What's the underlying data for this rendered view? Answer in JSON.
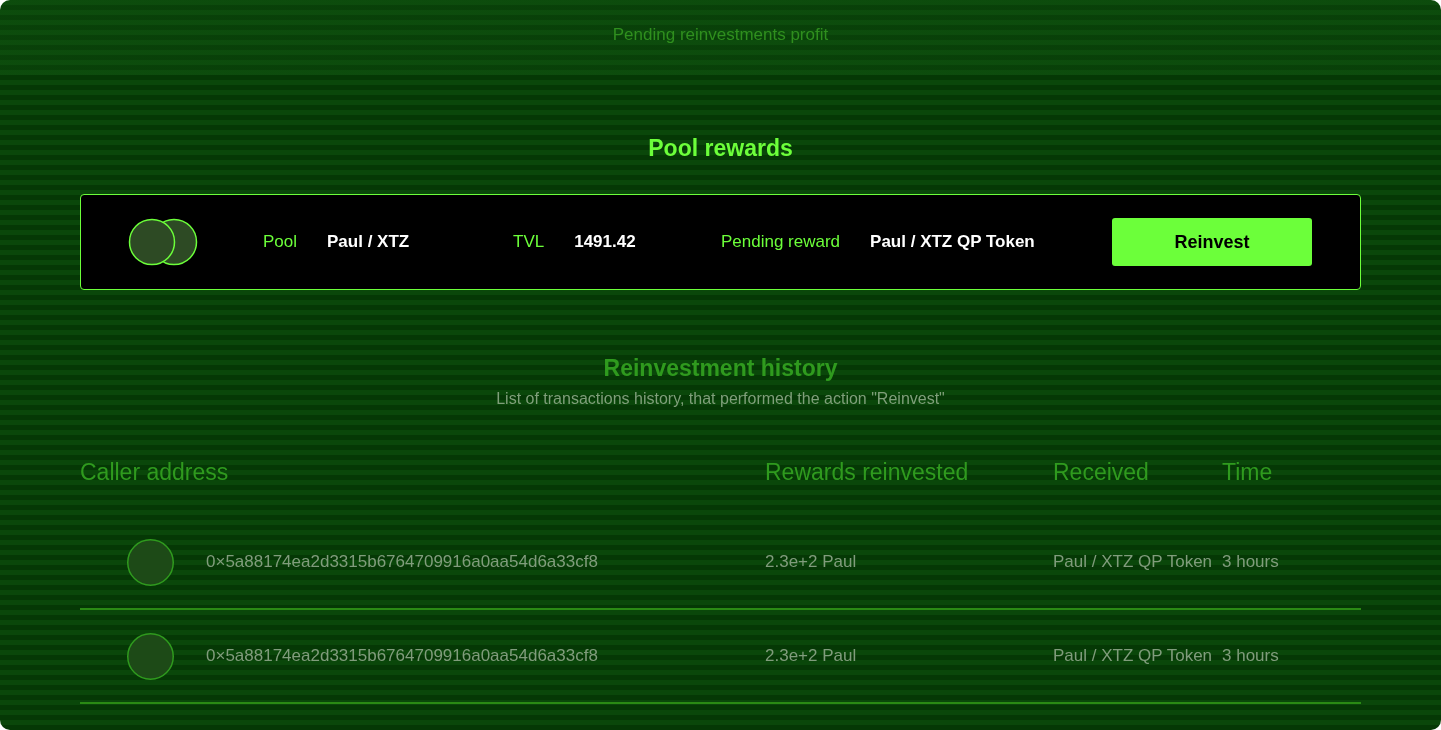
{
  "header": {
    "caption": "Pending reinvestments profit"
  },
  "pool_rewards": {
    "title": "Pool rewards",
    "stats": [
      {
        "label": "Pool",
        "value": "Paul / XTZ"
      },
      {
        "label": "TVL",
        "value": "1491.42"
      },
      {
        "label": "Pending reward",
        "value": "Paul / XTZ QP Token"
      }
    ],
    "button": "Reinvest"
  },
  "history": {
    "title": "Reinvestment history",
    "description": "List of transactions history, that performed the action \"Reinvest\"",
    "columns": [
      "Caller address",
      "Rewards reinvested",
      "Received",
      "Time"
    ],
    "rows": [
      {
        "caller_address": "0×5a88174ea2d3315b6764709916a0aa54d6a33cf8",
        "rewards_reinvested": "2.3e+2 Paul",
        "received": "Paul / XTZ QP Token",
        "time": "3 hours"
      },
      {
        "caller_address": "0×5a88174ea2d3315b6764709916a0aa54d6a33cf8",
        "rewards_reinvested": "2.3e+2 Paul",
        "received": "Paul / XTZ QP Token",
        "time": "3 hours"
      }
    ]
  }
}
